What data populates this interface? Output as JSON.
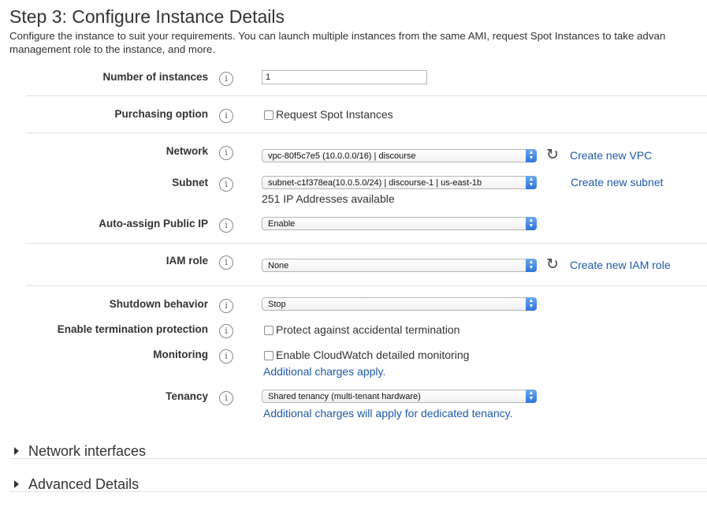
{
  "header": {
    "title": "Step 3: Configure Instance Details",
    "description": "Configure the instance to suit your requirements. You can launch multiple instances from the same AMI, request Spot Instances to take advan",
    "description_line2": "management role to the instance, and more."
  },
  "info_glyph": "i",
  "fields": {
    "num_instances": {
      "label": "Number of instances",
      "value": "1"
    },
    "purchasing": {
      "label": "Purchasing option",
      "checkbox_label": "Request Spot Instances",
      "checked": false
    },
    "network": {
      "label": "Network",
      "value": "vpc-80f5c7e5 (10.0.0.0/16) | discourse",
      "link": "Create new VPC"
    },
    "subnet": {
      "label": "Subnet",
      "value": "subnet-c1f378ea(10.0.5.0/24) | discourse-1 | us-east-1b",
      "link": "Create new subnet",
      "note": "251 IP Addresses available"
    },
    "public_ip": {
      "label": "Auto-assign Public IP",
      "value": "Enable"
    },
    "iam_role": {
      "label": "IAM role",
      "value": "None",
      "link": "Create new IAM role"
    },
    "shutdown": {
      "label": "Shutdown behavior",
      "value": "Stop"
    },
    "termination": {
      "label": "Enable termination protection",
      "checkbox_label": "Protect against accidental termination",
      "checked": false
    },
    "monitoring": {
      "label": "Monitoring",
      "checkbox_label": "Enable CloudWatch detailed monitoring",
      "checked": false,
      "link": "Additional charges apply."
    },
    "tenancy": {
      "label": "Tenancy",
      "value": "Shared tenancy (multi-tenant hardware)",
      "link": "Additional charges will apply for dedicated tenancy."
    }
  },
  "sections": {
    "network_interfaces": "Network interfaces",
    "advanced_details": "Advanced Details"
  },
  "colors": {
    "link": "#1f5aa8",
    "select_arrow": "#2f74d8",
    "divider": "#e3e3e3"
  },
  "icons": {
    "info": "info-circle-icon",
    "refresh": "refresh-icon",
    "expand": "triangle-right-icon",
    "select_arrow": "up-down-arrows-icon"
  }
}
